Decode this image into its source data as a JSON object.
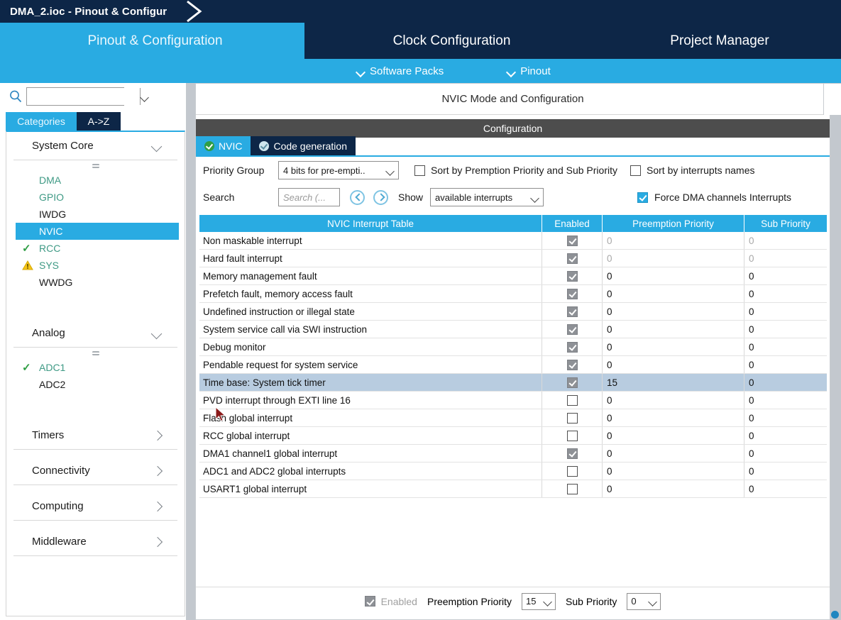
{
  "window": {
    "title": "DMA_2.ioc - Pinout & Configur"
  },
  "main_tabs": [
    {
      "label": "Pinout & Configuration",
      "active": true
    },
    {
      "label": "Clock Configuration",
      "active": false
    },
    {
      "label": "Project Manager",
      "active": false
    }
  ],
  "submenu": [
    {
      "label": "Software Packs",
      "icon": "chevron-down-icon"
    },
    {
      "label": "Pinout",
      "icon": "chevron-down-icon"
    }
  ],
  "sidebar": {
    "search": {
      "value": "",
      "placeholder": ""
    },
    "search_icon": "search-icon",
    "settings_icon": "gear-icon",
    "tabs": [
      {
        "label": "Categories",
        "active": true
      },
      {
        "label": "A->Z",
        "active": false
      }
    ],
    "groups": [
      {
        "title": "System Core",
        "expanded": true,
        "items": [
          {
            "label": "DMA",
            "status": "configured",
            "icon": "",
            "selected": false
          },
          {
            "label": "GPIO",
            "status": "configured",
            "icon": "",
            "selected": false
          },
          {
            "label": "IWDG",
            "status": "none",
            "icon": "",
            "selected": false
          },
          {
            "label": "NVIC",
            "status": "none",
            "icon": "",
            "selected": true
          },
          {
            "label": "RCC",
            "status": "configured",
            "icon": "check-icon",
            "selected": false
          },
          {
            "label": "SYS",
            "status": "configured",
            "icon": "warning-icon",
            "selected": false
          },
          {
            "label": "WWDG",
            "status": "none",
            "icon": "",
            "selected": false
          }
        ]
      },
      {
        "title": "Analog",
        "expanded": true,
        "items": [
          {
            "label": "ADC1",
            "status": "configured",
            "icon": "check-icon",
            "selected": false
          },
          {
            "label": "ADC2",
            "status": "none",
            "icon": "",
            "selected": false
          }
        ]
      },
      {
        "title": "Timers",
        "expanded": false,
        "items": []
      },
      {
        "title": "Connectivity",
        "expanded": false,
        "items": []
      },
      {
        "title": "Computing",
        "expanded": false,
        "items": []
      },
      {
        "title": "Middleware",
        "expanded": false,
        "items": []
      }
    ]
  },
  "content": {
    "mode_title": "NVIC Mode and Configuration",
    "configuration_band": "Configuration",
    "config_tabs": [
      {
        "label": "NVIC",
        "active": true,
        "icon": "circle-check-icon"
      },
      {
        "label": "Code generation",
        "active": false,
        "icon": "circle-check-icon"
      }
    ],
    "controls": {
      "priority_group_label": "Priority Group",
      "priority_group_value": "4 bits for pre-empti..",
      "sort_premption_label": "Sort by Premption Priority and Sub Priority",
      "sort_premption_checked": false,
      "sort_names_label": "Sort by interrupts names",
      "sort_names_checked": false,
      "search_label": "Search",
      "search_value": "",
      "search_placeholder": "Search (...",
      "prev_icon": "chevron-left-circle-icon",
      "next_icon": "chevron-right-circle-icon",
      "show_label": "Show",
      "show_value": "available interrupts",
      "force_dma_label": "Force DMA channels Interrupts",
      "force_dma_checked": true
    },
    "table": {
      "headers": [
        "NVIC Interrupt Table",
        "Enabled",
        "Preemption Priority",
        "Sub Priority"
      ],
      "rows": [
        {
          "name": "Non maskable interrupt",
          "enabled": true,
          "locked": true,
          "pre": "0",
          "sub": "0",
          "dim": true,
          "selected": false
        },
        {
          "name": "Hard fault interrupt",
          "enabled": true,
          "locked": true,
          "pre": "0",
          "sub": "0",
          "dim": true,
          "selected": false
        },
        {
          "name": "Memory management fault",
          "enabled": true,
          "locked": true,
          "pre": "0",
          "sub": "0",
          "dim": false,
          "selected": false
        },
        {
          "name": "Prefetch fault, memory access fault",
          "enabled": true,
          "locked": true,
          "pre": "0",
          "sub": "0",
          "dim": false,
          "selected": false
        },
        {
          "name": "Undefined instruction or illegal state",
          "enabled": true,
          "locked": true,
          "pre": "0",
          "sub": "0",
          "dim": false,
          "selected": false
        },
        {
          "name": "System service call via SWI instruction",
          "enabled": true,
          "locked": true,
          "pre": "0",
          "sub": "0",
          "dim": false,
          "selected": false
        },
        {
          "name": "Debug monitor",
          "enabled": true,
          "locked": true,
          "pre": "0",
          "sub": "0",
          "dim": false,
          "selected": false
        },
        {
          "name": "Pendable request for system service",
          "enabled": true,
          "locked": true,
          "pre": "0",
          "sub": "0",
          "dim": false,
          "selected": false
        },
        {
          "name": "Time base: System tick timer",
          "enabled": true,
          "locked": true,
          "pre": "15",
          "sub": "0",
          "dim": false,
          "selected": true
        },
        {
          "name": "PVD interrupt through EXTI line 16",
          "enabled": false,
          "locked": false,
          "pre": "0",
          "sub": "0",
          "dim": false,
          "selected": false
        },
        {
          "name": "Flash global interrupt",
          "enabled": false,
          "locked": false,
          "pre": "0",
          "sub": "0",
          "dim": false,
          "selected": false
        },
        {
          "name": "RCC global interrupt",
          "enabled": false,
          "locked": false,
          "pre": "0",
          "sub": "0",
          "dim": false,
          "selected": false
        },
        {
          "name": "DMA1 channel1 global interrupt",
          "enabled": true,
          "locked": true,
          "pre": "0",
          "sub": "0",
          "dim": false,
          "selected": false
        },
        {
          "name": "ADC1 and ADC2 global interrupts",
          "enabled": false,
          "locked": false,
          "pre": "0",
          "sub": "0",
          "dim": false,
          "selected": false
        },
        {
          "name": "USART1 global interrupt",
          "enabled": false,
          "locked": false,
          "pre": "0",
          "sub": "0",
          "dim": false,
          "selected": false
        }
      ]
    },
    "footer": {
      "enabled_label": "Enabled",
      "enabled_checked": true,
      "enabled_disabled": true,
      "preemption_label": "Preemption Priority",
      "preemption_value": "15",
      "sub_label": "Sub Priority",
      "sub_value": "0"
    }
  },
  "colors": {
    "title_bar": "#0d2647",
    "accent_blue": "#29abe2",
    "navy": "#0d2647",
    "band_gray": "#4d4d4d",
    "row_selected": "#b8cce0",
    "teal_text": "#3f9a85",
    "green_check": "#2f9e44",
    "warning_yellow": "#f5c518"
  }
}
